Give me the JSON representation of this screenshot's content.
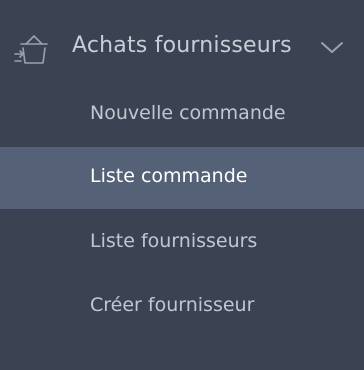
{
  "menu": {
    "title": "Achats fournisseurs",
    "icon": "basket-transfer-icon",
    "expand_icon": "chevron-down-icon",
    "items": [
      {
        "label": "Nouvelle commande",
        "active": false
      },
      {
        "label": "Liste commande",
        "active": true
      },
      {
        "label": "Liste fournisseurs",
        "active": false
      },
      {
        "label": "Créer fournisseur",
        "active": false
      }
    ]
  },
  "colors": {
    "sidebar_bg": "#3b4352",
    "active_item_bg": "#556177",
    "text": "#c2c7cf",
    "active_text": "#ffffff"
  }
}
